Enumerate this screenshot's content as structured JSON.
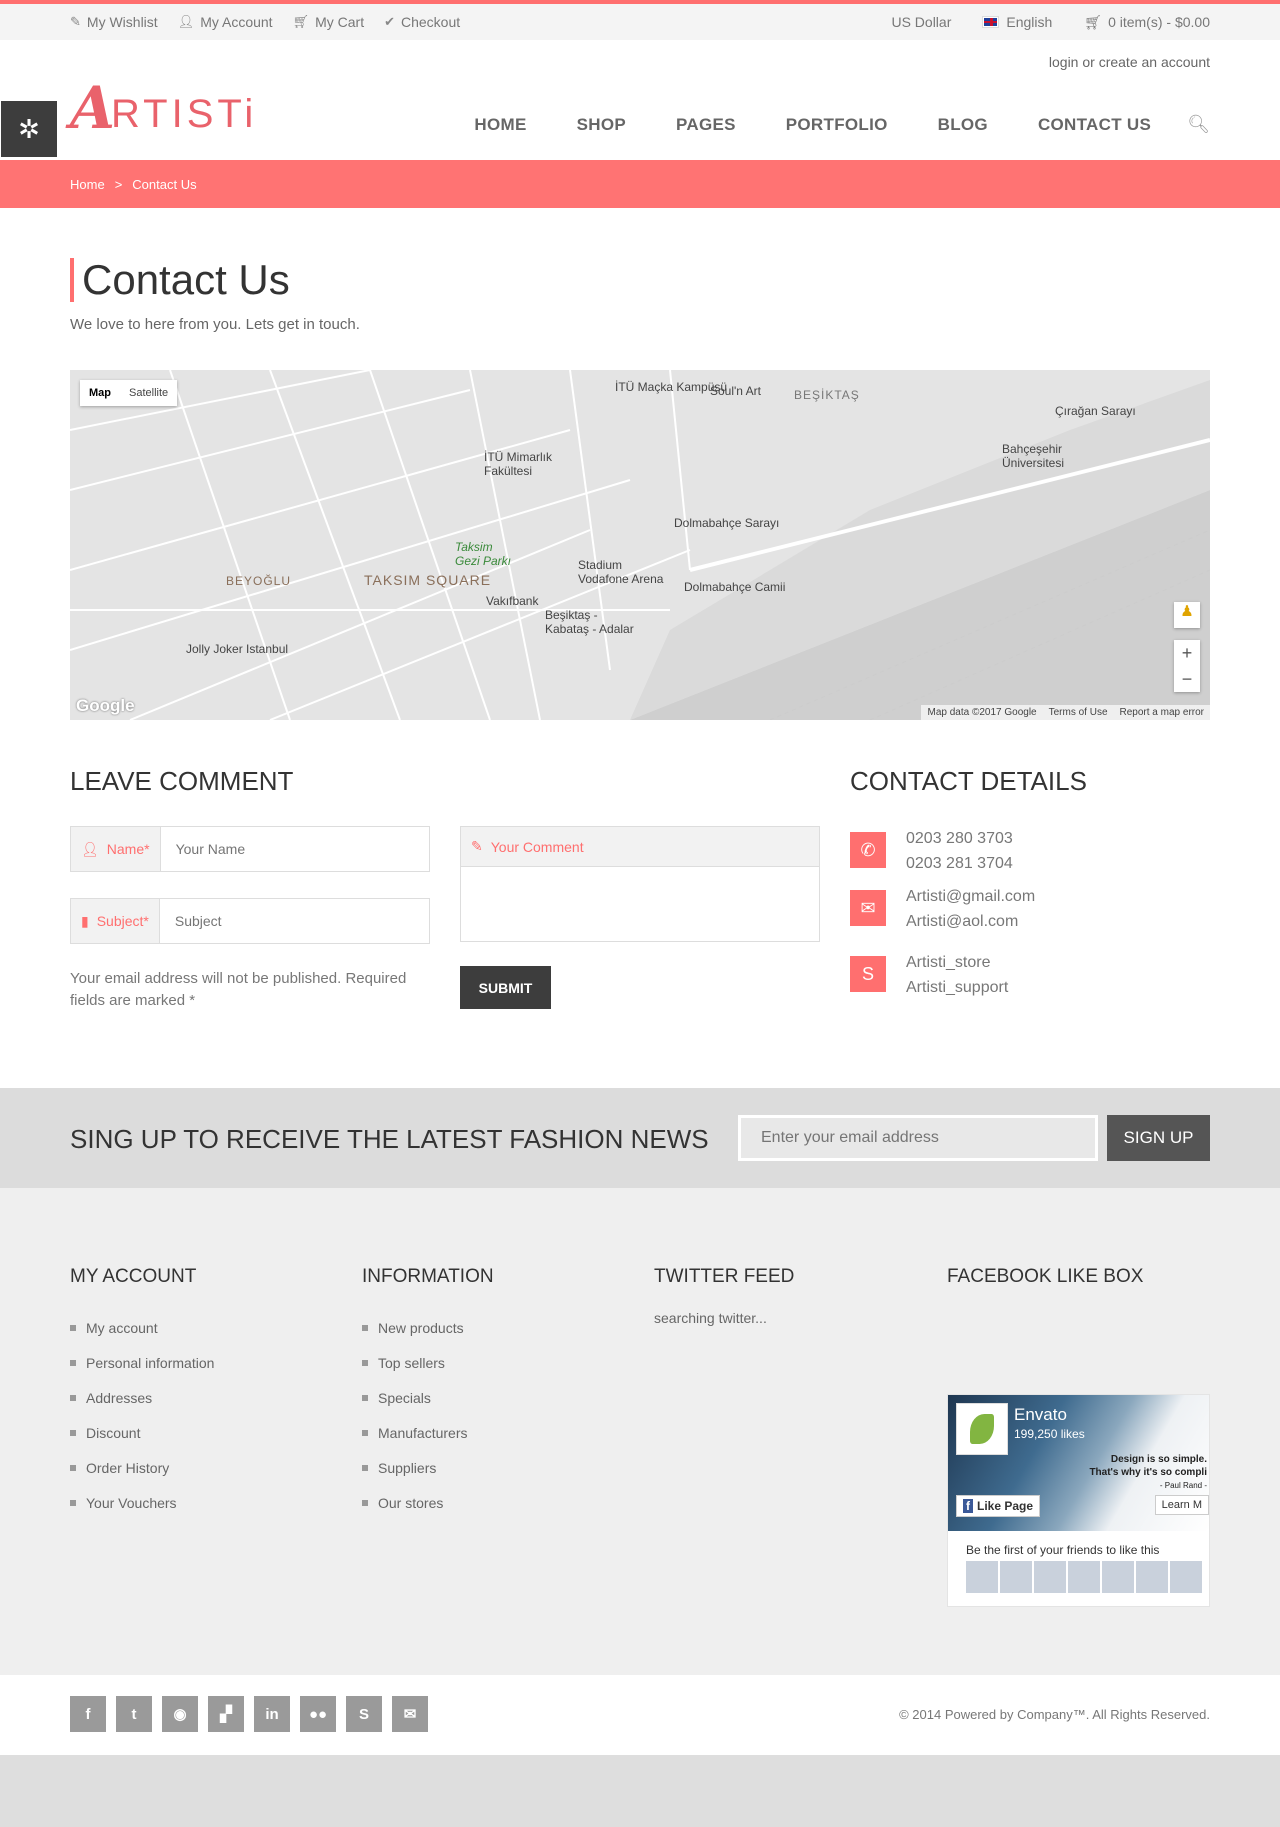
{
  "topbar": {
    "wishlist": "My Wishlist",
    "account": "My Account",
    "cart": "My Cart",
    "checkout": "Checkout",
    "currency": "US Dollar",
    "language": "English",
    "cart_summary": "0 item(s) - $0.00"
  },
  "header": {
    "login_text": "login or create an account",
    "logo_first": "A",
    "logo_rest": "RTISTi",
    "nav": [
      "HOME",
      "SHOP",
      "PAGES",
      "PORTFOLIO",
      "BLOG",
      "CONTACT US"
    ]
  },
  "breadcrumb": {
    "home": "Home",
    "separator": ">",
    "current": "Contact Us"
  },
  "page": {
    "title": "Contact Us",
    "subtitle": "We love to here from you. Lets get in touch."
  },
  "map": {
    "type_map": "Map",
    "type_satellite": "Satellite",
    "labels": [
      "İTÜ Maçka Kampüsü",
      "Soul'n Art",
      "BEŞİKTAŞ",
      "Çırağan Sarayı",
      "Bahçeşehir Üniversitesi",
      "İTÜ Mimarlık Fakültesi",
      "Taksim Gezi Parkı",
      "Stadium Vodafone Arena",
      "Dolmabahçe Sarayı",
      "BEYOĞLU",
      "TAKSIM SQUARE",
      "Vakıfbank",
      "Dolmabahçe Camii",
      "Beşiktaş - Kabataş - Adalar",
      "Jolly Joker Istanbul"
    ],
    "attribution": [
      "Map data ©2017 Google",
      "Terms of Use",
      "Report a map error"
    ],
    "google": "Google"
  },
  "form": {
    "heading": "LEAVE COMMENT",
    "name_label": "Name*",
    "name_placeholder": "Your Name",
    "subject_label": "Subject*",
    "subject_placeholder": "Subject",
    "comment_label": "Your Comment",
    "note": "Your email address will not be published. Required fields are marked *",
    "submit": "SUBMIT"
  },
  "contact": {
    "heading": "CONTACT DETAILS",
    "phone1": "0203 280 3703",
    "phone2": "0203 281 3704",
    "email1": "Artisti@gmail.com",
    "email2": "Artisti@aol.com",
    "skype1": "Artisti_store",
    "skype2": "Artisti_support"
  },
  "newsletter": {
    "title": "SING UP TO RECEIVE THE LATEST FASHION NEWS",
    "placeholder": "Enter your email address",
    "button": "SIGN UP"
  },
  "footer": {
    "account_title": "MY ACCOUNT",
    "account_items": [
      "My account",
      "Personal information",
      "Addresses",
      "Discount",
      "Order History",
      "Your Vouchers"
    ],
    "info_title": "INFORMATION",
    "info_items": [
      "New products",
      "Top sellers",
      "Specials",
      "Manufacturers",
      "Suppliers",
      "Our stores"
    ],
    "twitter_title": "TWITTER FEED",
    "twitter_text": "searching twitter...",
    "facebook_title": "FACEBOOK LIKE BOX",
    "fb_name": "Envato",
    "fb_likes": "199,250 likes",
    "fb_quote1": "Design is so simple.",
    "fb_quote2": "That's why it's so compli",
    "fb_quote3": "- Paul Rand -",
    "fb_like_button": "Like Page",
    "fb_learn": "Learn M",
    "fb_first": "Be the first of your friends to like this"
  },
  "bottom": {
    "copyright": "© 2014 Powered by Company™. All Rights Reserved."
  },
  "colors": {
    "accent": "#ff6f6f",
    "dark": "#3d3d3d"
  }
}
